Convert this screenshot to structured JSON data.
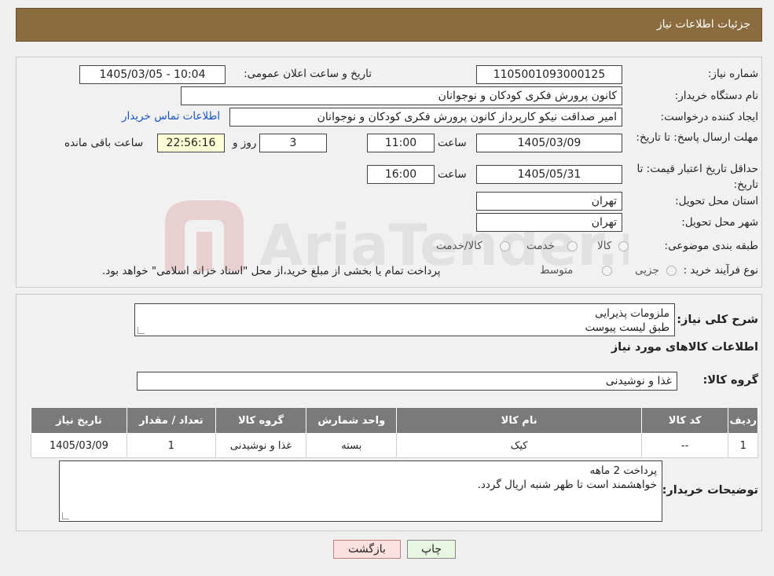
{
  "header": {
    "title": "جزئیات اطلاعات نیاز"
  },
  "watermark": {
    "text": "AriaTender.neT"
  },
  "form": {
    "need_number_label": "شماره نیاز:",
    "need_number": "1105001093000125",
    "announce_label": "تاریخ و ساعت اعلان عمومی:",
    "announce_value": "1405/03/05 - 10:04",
    "buyer_org_label": "نام دستگاه خریدار:",
    "buyer_org": "کانون پرورش فکری کودکان و نوجوانان",
    "creator_label": "ایجاد کننده درخواست:",
    "creator": "امیر صداقت نیکو کارپرداز کانون پرورش فکری کودکان و نوجوانان",
    "contact_link": "اطلاعات تماس خریدار",
    "reply_deadline_label": "مهلت ارسال پاسخ: تا تاریخ:",
    "reply_date": "1405/03/09",
    "time_label": "ساعت",
    "reply_time": "11:00",
    "days_value": "3",
    "days_label": "روز و",
    "remaining_value": "22:56:16",
    "remaining_label": "ساعت باقی مانده",
    "price_valid_label": "حداقل تاریخ اعتبار قیمت: تا تاریخ:",
    "price_valid_date": "1405/05/31",
    "price_valid_time": "16:00",
    "province_label": "استان محل تحویل:",
    "province": "تهران",
    "city_label": "شهر محل تحویل:",
    "city": "تهران",
    "category_label": "طبقه بندی موضوعی:",
    "category_options": [
      "کالا",
      "خدمت",
      "کالا/خدمت"
    ],
    "process_label": "نوع فرآیند خرید :",
    "process_options": [
      "جزیی",
      "متوسط"
    ],
    "process_note": "پرداخت تمام یا بخشی از مبلغ خرید،از محل \"اسناد خزانه اسلامی\" خواهد بود."
  },
  "details": {
    "summary_label": "شرح کلی نیاز:",
    "summary_lines": [
      "ملزومات پذیرایی",
      "طبق لیست پیوست"
    ],
    "goods_info_title": "اطلاعات کالاهای مورد نیاز",
    "goods_group_label": "گروه کالا:",
    "goods_group": "غذا و نوشیدنی",
    "table": {
      "headers": [
        "ردیف",
        "کد کالا",
        "نام کالا",
        "واحد شمارش",
        "گروه کالا",
        "تعداد / مقدار",
        "تاریخ نیاز"
      ],
      "rows": [
        [
          "1",
          "--",
          "کیک",
          "بسته",
          "غذا و نوشیدنی",
          "1",
          "1405/03/09"
        ]
      ]
    },
    "buyer_notes_label": "توضیحات خریدار:",
    "buyer_notes_lines": [
      "پرداخت 2 ماهه",
      "خواهشمند است تا ظهر شنبه اریال گردد."
    ]
  },
  "buttons": {
    "print": "چاپ",
    "back": "بازگشت"
  },
  "colors": {
    "header_bg": "#8b6c3e",
    "link": "#1a55c8",
    "table_header": "#7a7a7a",
    "remaining_bg": "#ffffd8",
    "back_bg": "#fde0e0",
    "print_bg": "#e6f6e0"
  }
}
